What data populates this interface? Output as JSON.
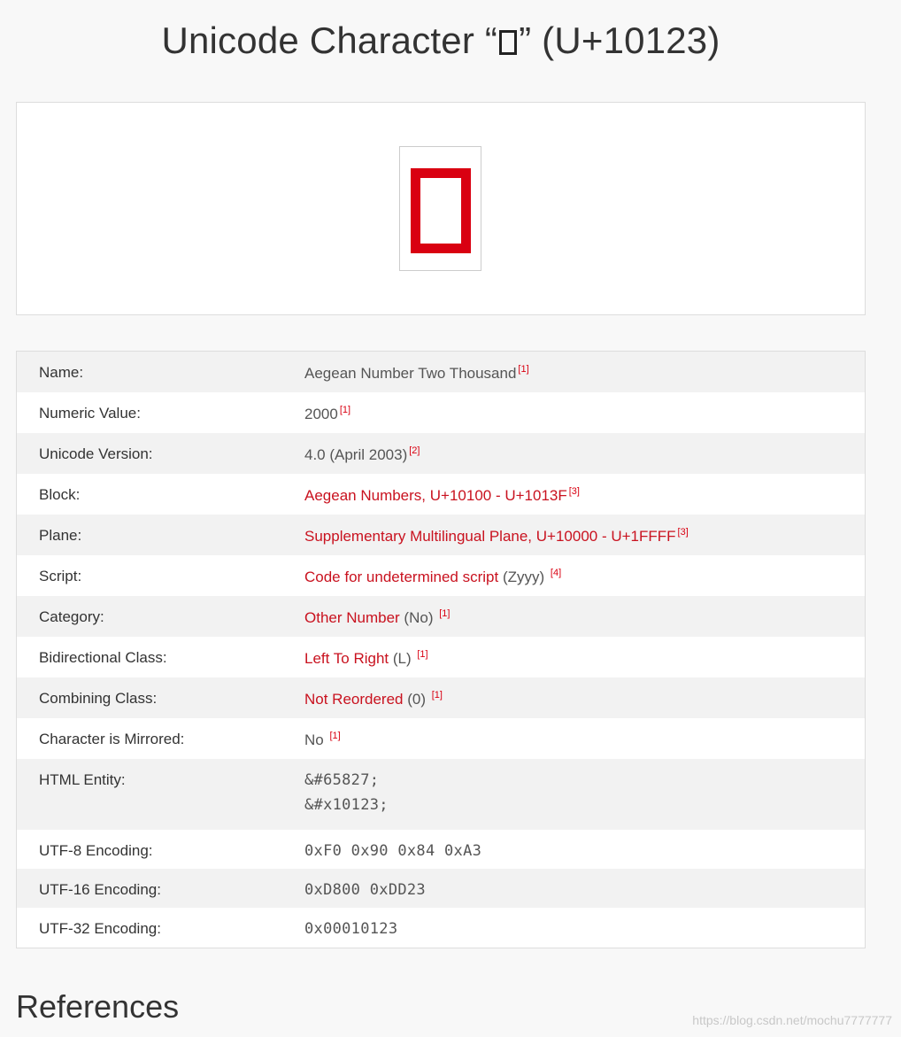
{
  "page": {
    "title_prefix": "Unicode Character “",
    "title_suffix": "” (U+10123)"
  },
  "rows": [
    {
      "label": "Name:",
      "value": "Aegean Number Two Thousand",
      "ref": "[1]"
    },
    {
      "label": "Numeric Value:",
      "value": "2000",
      "ref": "[1]"
    },
    {
      "label": "Unicode Version:",
      "value": "4.0 (April 2003)",
      "ref": "[2]"
    },
    {
      "label": "Block:",
      "link": "Aegean Numbers, U+10100 - U+1013F",
      "ref": "[3]"
    },
    {
      "label": "Plane:",
      "link": "Supplementary Multilingual Plane, U+10000 - U+1FFFF",
      "ref": "[3]"
    },
    {
      "label": "Script:",
      "link": "Code for undetermined script",
      "extra": " (Zyyy) ",
      "ref": "[4]"
    },
    {
      "label": "Category:",
      "link": "Other Number",
      "extra": " (No) ",
      "ref": "[1]"
    },
    {
      "label": "Bidirectional Class:",
      "link": "Left To Right",
      "extra": " (L) ",
      "ref": "[1]"
    },
    {
      "label": "Combining Class:",
      "link": "Not Reordered",
      "extra": " (0) ",
      "ref": "[1]"
    },
    {
      "label": "Character is Mirrored:",
      "value": "No ",
      "ref": "[1]"
    },
    {
      "label": "HTML Entity:",
      "entity_dec": "&#65827;",
      "entity_hex": "&#x10123;"
    },
    {
      "label": "UTF-8 Encoding:",
      "code": "0xF0 0x90 0x84 0xA3"
    },
    {
      "label": "UTF-16 Encoding:",
      "code": "0xD800 0xDD23"
    },
    {
      "label": "UTF-32 Encoding:",
      "code": "0x00010123"
    }
  ],
  "references_heading": "References",
  "watermark": "https://blog.csdn.net/mochu7777777",
  "colors": {
    "accent": "#d90011",
    "code": "#1c4f7a"
  }
}
